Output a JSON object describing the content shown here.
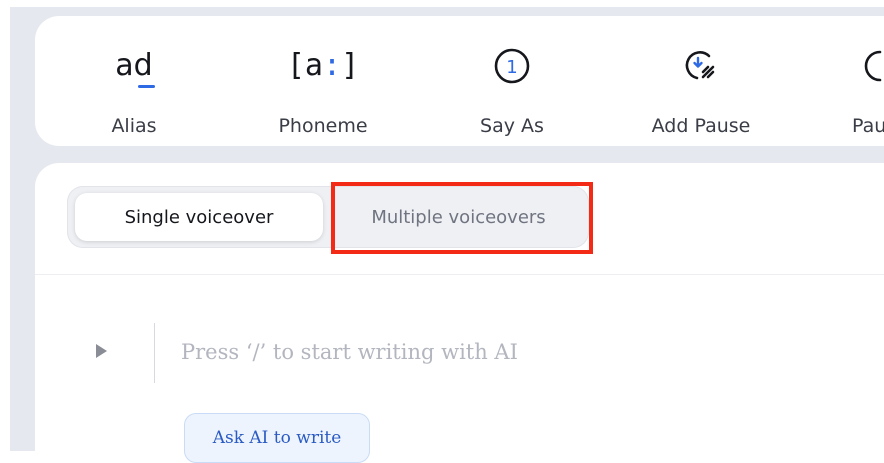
{
  "toolbar": {
    "items": [
      {
        "label": "Alias",
        "icon": "alias-icon",
        "glyph": "ad"
      },
      {
        "label": "Phoneme",
        "icon": "phoneme-icon",
        "glyph_left": "[a",
        "glyph_colon": ":",
        "glyph_right": "]"
      },
      {
        "label": "Say As",
        "icon": "say-as-icon",
        "glyph": "1"
      },
      {
        "label": "Add Pause",
        "icon": "add-pause-icon"
      },
      {
        "label": "Pause",
        "icon": "pause-icon"
      }
    ]
  },
  "voiceover_toggle": {
    "options": [
      "Single voiceover",
      "Multiple voiceovers"
    ],
    "selected": "Single voiceover"
  },
  "editor": {
    "placeholder": "Press ‘/’ to start writing with AI",
    "ask_ai_label": "Ask AI to write"
  },
  "colors": {
    "accent": "#2f6ae5",
    "highlight": "#f22a16",
    "background": "#e6e8ef"
  }
}
